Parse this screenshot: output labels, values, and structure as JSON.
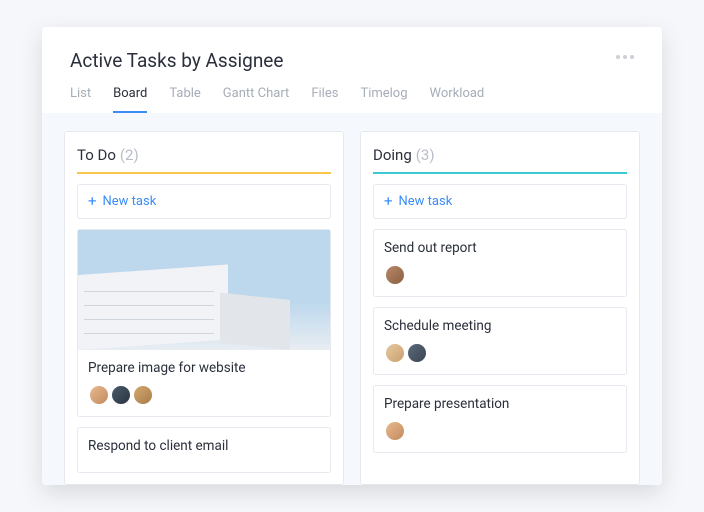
{
  "header": {
    "title": "Active Tasks by Assignee"
  },
  "tabs": [
    {
      "label": "List",
      "active": false
    },
    {
      "label": "Board",
      "active": true
    },
    {
      "label": "Table",
      "active": false
    },
    {
      "label": "Gantt Chart",
      "active": false
    },
    {
      "label": "Files",
      "active": false
    },
    {
      "label": "Timelog",
      "active": false
    },
    {
      "label": "Workload",
      "active": false
    }
  ],
  "columns": [
    {
      "title": "To Do",
      "count": "(2)",
      "accent": "yellow",
      "new_task_label": "New task",
      "tasks": [
        {
          "title": "Prepare image for website",
          "has_image": true,
          "avatars": [
            "av1",
            "av2",
            "av3"
          ]
        },
        {
          "title": "Respond to client email",
          "has_image": false,
          "avatars": []
        }
      ]
    },
    {
      "title": "Doing",
      "count": "(3)",
      "accent": "teal",
      "new_task_label": "New task",
      "tasks": [
        {
          "title": "Send out report",
          "has_image": false,
          "avatars": [
            "av4"
          ]
        },
        {
          "title": "Schedule meeting",
          "has_image": false,
          "avatars": [
            "av5",
            "av6"
          ]
        },
        {
          "title": "Prepare presentation",
          "has_image": false,
          "avatars": [
            "av1"
          ]
        }
      ]
    }
  ]
}
